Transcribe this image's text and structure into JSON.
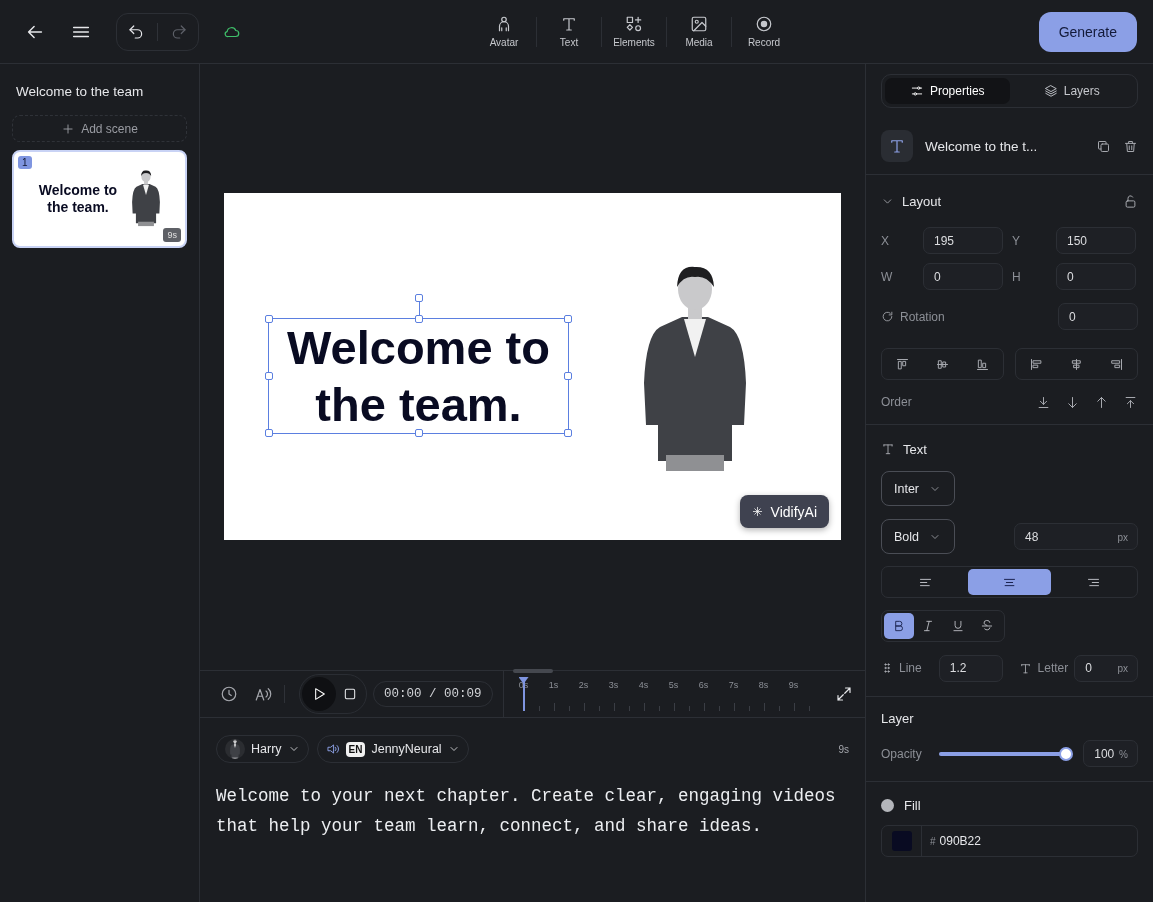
{
  "toolbar": {
    "tools": [
      {
        "kind": "avatar",
        "label": "Avatar"
      },
      {
        "kind": "text",
        "label": "Text"
      },
      {
        "kind": "elements",
        "label": "Elements"
      },
      {
        "kind": "media",
        "label": "Media"
      },
      {
        "kind": "record",
        "label": "Record"
      }
    ],
    "generate": "Generate"
  },
  "sidebar": {
    "title": "Welcome to the team",
    "add_scene": "Add scene",
    "scenes": [
      {
        "number": "1",
        "text": "Welcome to the team.",
        "duration": "9s",
        "selected": true
      }
    ]
  },
  "canvas": {
    "text": "Welcome to the team.",
    "text_selected": true,
    "badge": "VidifyAi"
  },
  "timeline": {
    "time": "00:00 / 00:09",
    "ticks": [
      "0s",
      "1s",
      "2s",
      "3s",
      "4s",
      "5s",
      "6s",
      "7s",
      "8s",
      "9s"
    ]
  },
  "script": {
    "avatar": "Harry",
    "language": "EN",
    "voice": "JennyNeural",
    "duration": "9s",
    "text": "Welcome to your next chapter. Create clear, engaging videos that help your team learn, connect, and share ideas."
  },
  "properties": {
    "tabs": [
      {
        "kind": "properties",
        "label": "Properties",
        "selected": true
      },
      {
        "kind": "layers",
        "label": "Layers",
        "selected": false
      }
    ],
    "element_name": "Welcome to the t...",
    "layout": {
      "title": "Layout",
      "fields": [
        {
          "label": "X",
          "value": "195"
        },
        {
          "label": "Y",
          "value": "150"
        },
        {
          "label": "W",
          "value": "0"
        },
        {
          "label": "H",
          "value": "0"
        }
      ],
      "rotation_label": "Rotation",
      "rotation": "0",
      "order_label": "Order"
    },
    "text": {
      "title": "Text",
      "font": "Inter",
      "weight": "Bold",
      "size": "48",
      "size_unit": "px",
      "align": [
        {
          "kind": "left",
          "selected": false
        },
        {
          "kind": "center",
          "selected": true
        },
        {
          "kind": "right",
          "selected": false
        }
      ],
      "styles": [
        {
          "kind": "bold",
          "selected": true
        },
        {
          "kind": "italic",
          "selected": false
        },
        {
          "kind": "underline",
          "selected": false
        },
        {
          "kind": "strike",
          "selected": false
        }
      ],
      "line_label": "Line",
      "line": "1.2",
      "letter_label": "Letter",
      "letter": "0",
      "letter_unit": "px"
    },
    "layer": {
      "title": "Layer",
      "opacity_label": "Opacity",
      "level": 1,
      "opacity": "100",
      "unit": "%"
    },
    "fill": {
      "title": "Fill",
      "prefix": "#",
      "hex": "090B22"
    }
  }
}
